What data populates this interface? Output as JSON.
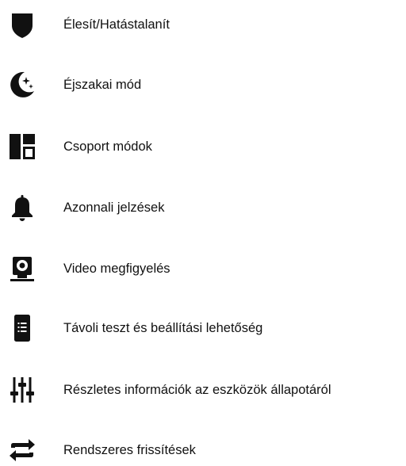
{
  "features": [
    {
      "label": "Élesít/Hatástalanít",
      "icon": "shield-icon"
    },
    {
      "label": "Éjszakai mód",
      "icon": "night-mode-icon"
    },
    {
      "label": "Csoport módok",
      "icon": "group-modes-icon"
    },
    {
      "label": "Azonnali jelzések",
      "icon": "bell-icon"
    },
    {
      "label": "Video megfigyelés",
      "icon": "camera-icon"
    },
    {
      "label": "Távoli teszt és beállítási lehetőség",
      "icon": "remote-device-icon"
    },
    {
      "label": "Részletes információk az eszközök állapotáról",
      "icon": "sliders-icon"
    },
    {
      "label": "Rendszeres frissítések",
      "icon": "refresh-icon"
    }
  ],
  "colors": {
    "icon": "#111111",
    "text": "#111111",
    "background": "#ffffff"
  }
}
